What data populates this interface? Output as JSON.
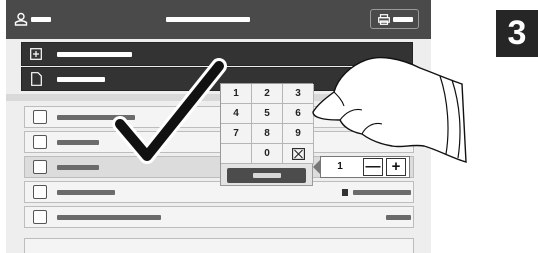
{
  "step_badge": "3",
  "keypad": {
    "keys": [
      "1",
      "2",
      "3",
      "4",
      "5",
      "6",
      "7",
      "8",
      "9",
      "",
      "0"
    ],
    "clear_key_icon": "clear-x-icon",
    "enter_key_icon": "blank-bar"
  },
  "quantity": {
    "value": "1",
    "decrement_label": "—",
    "increment_label": "+"
  },
  "header": {
    "left_icon": "user-icon",
    "right_icon": "printer-icon"
  },
  "menu_rows": [
    {
      "icon": "plus-box-icon"
    },
    {
      "icon": "document-icon"
    }
  ],
  "feature_rows": [
    {
      "icon": "paper-source-icon"
    },
    {
      "icon": "copies-icon"
    },
    {
      "icon": "quantity-icon"
    },
    {
      "icon": "list-icon"
    },
    {
      "icon": "layout-icon"
    }
  ],
  "colors": {
    "header": "#4a4a4a",
    "panel": "#eeeeee",
    "badge": "#262626"
  }
}
